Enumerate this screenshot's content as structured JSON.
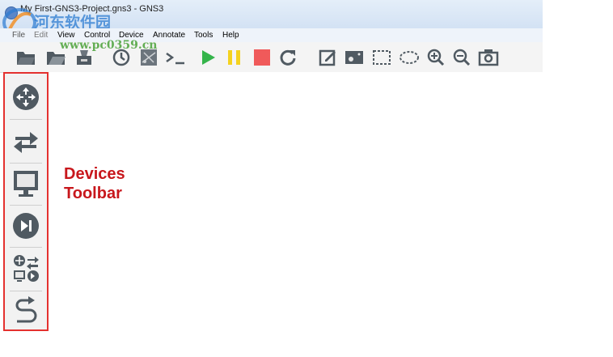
{
  "window": {
    "title": "My First-GNS3-Project.gns3 - GNS3"
  },
  "watermark": {
    "brand": "河东软件园",
    "url": "www.pc0359.cn"
  },
  "menu": {
    "items": [
      "File",
      "Edit",
      "View",
      "Control",
      "Device",
      "Annotate",
      "Tools",
      "Help"
    ]
  },
  "toolbar": {
    "icons": [
      "new-project-icon",
      "open-project-icon",
      "save-project-icon",
      "snapshot-icon",
      "show-interface-labels-icon",
      "console-all-icon",
      "start-all-icon",
      "suspend-all-icon",
      "stop-all-icon",
      "reload-all-icon",
      "add-note-icon",
      "insert-picture-icon",
      "draw-rectangle-icon",
      "draw-ellipse-icon",
      "zoom-in-icon",
      "zoom-out-icon",
      "screenshot-icon"
    ],
    "colors": {
      "start": "#34b44a",
      "suspend": "#f4d21f",
      "stop": "#f05a5a",
      "icon": "#505a62"
    }
  },
  "devices_panel": {
    "icons": [
      "router-icon",
      "switch-icon",
      "end-device-icon",
      "security-device-icon",
      "all-devices-icon",
      "add-link-icon"
    ],
    "highlight_color": "#e4312f"
  },
  "annotation": {
    "line1": "Devices",
    "line2": "Toolbar",
    "color": "#c8171c"
  }
}
